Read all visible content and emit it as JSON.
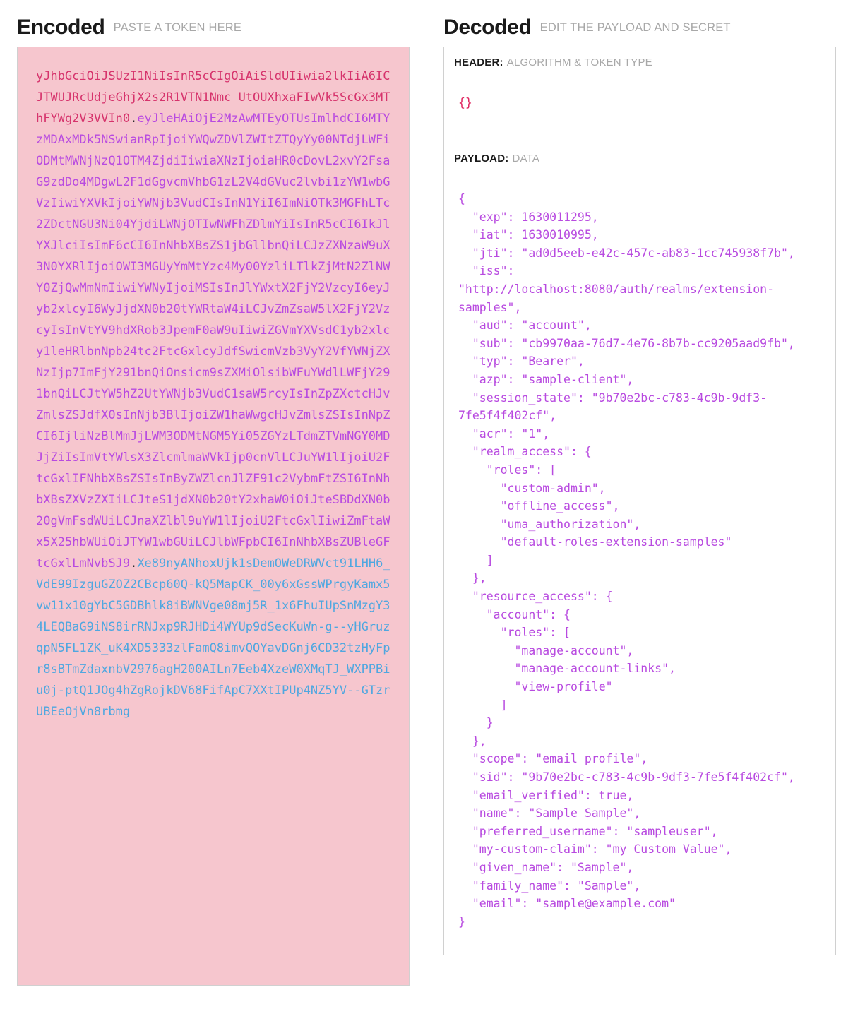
{
  "encoded": {
    "title": "Encoded",
    "subtitle": "PASTE A TOKEN HERE",
    "token": {
      "header_part": "yJhbGciOiJSUzI1NiIsInR5cCIgOiAiSldUIiwia2lkIiA6ICJTWUJRcUdjeGhjX2s2R1VTN1Nmc UtOUXhxaFIwVk5ScGx3MThFYWg2V3VVIn0",
      "payload_part": "eyJleHAiOjE2MzAwMTEyOTUsImlhdCI6MTYzMDAxMDk5NSwianRpIjoiYWQwZDVlZWItZTQyYy00NTdjLWFiODMtMWNjNzQ1OTM4ZjdiIiwiaXNzIjoiaHR0cDovL2xvY2FsaG9zdDo4MDgwL2F1dGgvcmVhbG1zL2V4dGVuc2lvbi1zYW1wbGVzIiwiYXVkIjoiYWNjb3VudCIsInN1YiI6ImNiOTk3MGFhLTc2ZDctNGU3Ni04YjdiLWNjOTIwNWFhZDlmYiIsInR5cCI6IkJlYXJlciIsImF6cCI6InNhbXBsZS1jbGllbnQiLCJzZXNzaW9uX3N0YXRlIjoiOWI3MGUyYmMtYzc4My00YzliLTlkZjMtN2ZlNWY0ZjQwMmNmIiwiYWNyIjoiMSIsInJlYWxtX2FjY2VzcyI6eyJyb2xlcyI6WyJjdXN0b20tYWRtaW4iLCJvZmZsaW5lX2FjY2VzcyIsInVtYV9hdXRob3JpemF0aW9uIiwiZGVmYXVsdC1yb2xlcy1leHRlbnNpb24tc2FtcGxlcyJdfSwicmVzb3VyY2VfYWNjZXNzIjp7ImFjY291bnQiOnsicm9sZXMiOlsibWFuYWdlLWFjY291bnQiLCJtYW5hZ2UtYWNjb3VudC1saW5rcyIsInZpZXctcHJvZmlsZSJdfX0sInNjb3BlIjoiZW1haWwgcHJvZmlsZSIsInNpZCI6IjliNzBlMmJjLWM3ODMtNGM5Yi05ZGYzLTdmZTVmNGY0MDJjZiIsImVtYWlsX3ZlcmlmaWVkIjp0cnVlLCJuYW1lIjoiU2FtcGxlIFNhbXBsZSIsInByZWZlcnJlZF91c2VybmFtZSI6InNhbXBsZXVzZXIiLCJteS1jdXN0b20tY2xhaW0iOiJteSBDdXN0b20gVmFsdWUiLCJnaXZlbl9uYW1lIjoiU2FtcGxlIiwiZmFtaWx5X25hbWUiOiJTYW1wbGUiLCJlbWFpbCI6InNhbXBsZUBleGFtcGxlLmNvbSJ9",
      "signature_part": "Xe89nyANhoxUjk1sDemOWeDRWVct91LHH6_VdE99IzguGZOZ2CBcp60Q-kQ5MapCK_00y6xGssWPrgyKamx5vw11x10gYbC5GDBhlk8iBWNVge08mj5R_1x6FhuIUpSnMzgY34LEQBaG9iNS8irRNJxp9RJHDi4WYUp9dSecKuWn-g--yHGruzqpN5FL1ZK_uK4XD5333zlFamQ8imvQOYavDGnj6CD32tzHyFpr8sBTmZdaxnbV2976agH200AILn7Eeb4XzeW0XMqTJ_WXPPBiu0j-ptQ1JOg4hZgRojkDV68FifApC7XXtIPUp4NZ5YV--GTzrUBEeOjVn8rbmg",
      "separator": "."
    },
    "colors": {
      "background": "#f6c6ce",
      "header_color": "#d6336c",
      "payload_color": "#b84ae0",
      "signature_color": "#4fa7e0"
    }
  },
  "decoded": {
    "title": "Decoded",
    "subtitle": "EDIT THE PAYLOAD AND SECRET",
    "header_section": {
      "label": "HEADER:",
      "sub": "ALGORITHM & TOKEN TYPE",
      "content": "{}"
    },
    "payload_section": {
      "label": "PAYLOAD:",
      "sub": "DATA",
      "content": "{\n  \"exp\": 1630011295,\n  \"iat\": 1630010995,\n  \"jti\": \"ad0d5eeb-e42c-457c-ab83-1cc745938f7b\",\n  \"iss\": \"http://localhost:8080/auth/realms/extension-samples\",\n  \"aud\": \"account\",\n  \"sub\": \"cb9970aa-76d7-4e76-8b7b-cc9205aad9fb\",\n  \"typ\": \"Bearer\",\n  \"azp\": \"sample-client\",\n  \"session_state\": \"9b70e2bc-c783-4c9b-9df3-7fe5f4f402cf\",\n  \"acr\": \"1\",\n  \"realm_access\": {\n    \"roles\": [\n      \"custom-admin\",\n      \"offline_access\",\n      \"uma_authorization\",\n      \"default-roles-extension-samples\"\n    ]\n  },\n  \"resource_access\": {\n    \"account\": {\n      \"roles\": [\n        \"manage-account\",\n        \"manage-account-links\",\n        \"view-profile\"\n      ]\n    }\n  },\n  \"scope\": \"email profile\",\n  \"sid\": \"9b70e2bc-c783-4c9b-9df3-7fe5f4f402cf\",\n  \"email_verified\": true,\n  \"name\": \"Sample Sample\",\n  \"preferred_username\": \"sampleuser\",\n  \"my-custom-claim\": \"my Custom Value\",\n  \"given_name\": \"Sample\",\n  \"family_name\": \"Sample\",\n  \"email\": \"sample@example.com\"\n}"
    },
    "colors": {
      "header_code_color": "#e0245e",
      "payload_code_color": "#b84ae0",
      "border": "#d0d0d0"
    }
  }
}
